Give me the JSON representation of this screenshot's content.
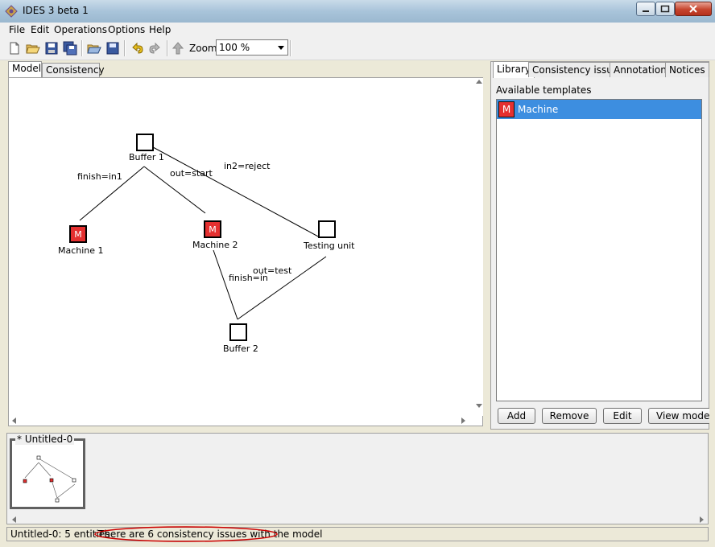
{
  "window": {
    "title": "IDES 3 beta 1"
  },
  "menu": [
    "File",
    "Edit",
    "Operations",
    "Options",
    "Help"
  ],
  "toolbar": {
    "zoom_label": "Zoom:",
    "zoom_value": "100 %",
    "icons": [
      "new-icon",
      "open-icon",
      "save-icon",
      "save-all-icon",
      "open-workspace-icon",
      "save-workspace-icon",
      "undo-icon",
      "redo-icon",
      "up-icon"
    ]
  },
  "left_tabs": [
    "Model",
    "Consistency"
  ],
  "model": {
    "nodes": [
      {
        "id": "buffer1",
        "label": "Buffer 1",
        "marker": ""
      },
      {
        "id": "machine1",
        "label": "Machine 1",
        "marker": "M"
      },
      {
        "id": "machine2",
        "label": "Machine 2",
        "marker": "M"
      },
      {
        "id": "testing",
        "label": "Testing unit",
        "marker": ""
      },
      {
        "id": "buffer2",
        "label": "Buffer 2",
        "marker": ""
      }
    ],
    "edges": [
      {
        "label": "finish=in1"
      },
      {
        "label": "out=start"
      },
      {
        "label": "in2=reject"
      },
      {
        "label": "finish=in"
      },
      {
        "label": "out=test"
      }
    ]
  },
  "right_tabs": [
    "Library",
    "Consistency issues",
    "Annotations",
    "Notices"
  ],
  "library": {
    "available_label": "Available templates",
    "templates": [
      {
        "icon": "M",
        "name": "Machine"
      }
    ],
    "buttons": [
      "Add",
      "Remove",
      "Edit",
      "View model"
    ]
  },
  "filmstrip": {
    "model_name": "* Untitled-0"
  },
  "status": {
    "model": "Untitled-0:  5 entities",
    "message": "There are 6 consistency issues with the model"
  },
  "colors": {
    "selection": "#3d8ee0",
    "machine": "#e53030",
    "highlight_ellipse": "#cc0000"
  }
}
